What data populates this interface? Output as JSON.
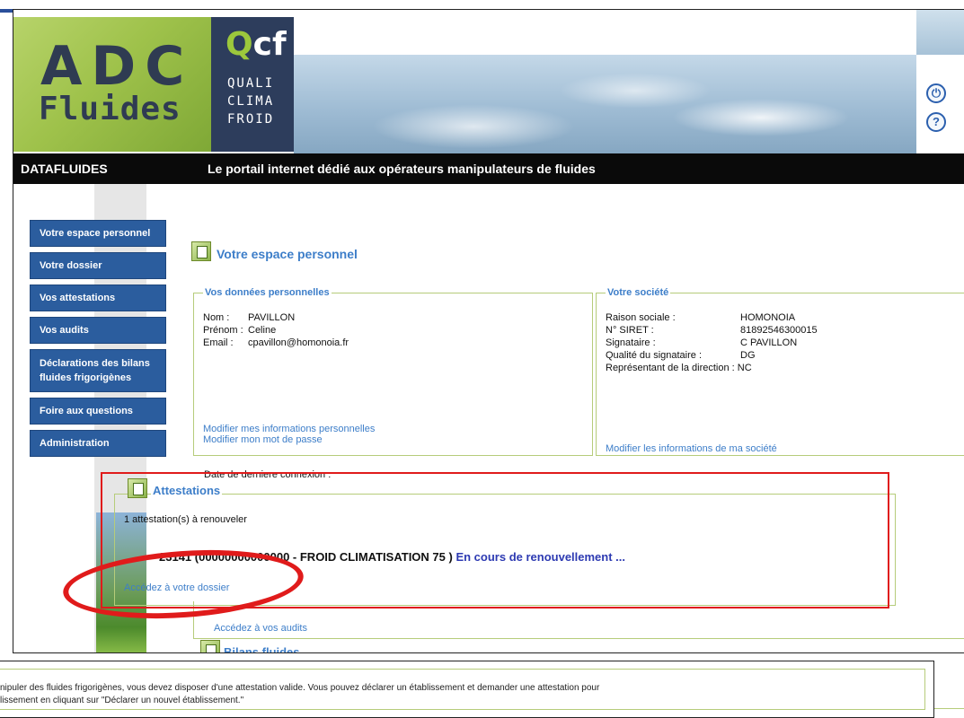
{
  "header": {
    "logo_adc": "ADC",
    "logo_fluides": "Fluides",
    "logo_qcf_mark": "Q",
    "logo_qcf_mark_rest": "cf",
    "logo_qcf_lines": [
      "QUALI",
      "CLIMA",
      "FROID"
    ],
    "power_glyph": "⏻",
    "help_glyph": "?"
  },
  "band": {
    "brand": "DATAFLUIDES",
    "tagline": "Le portail internet dédié aux opérateurs manipulateurs de fluides"
  },
  "nav": {
    "items": [
      {
        "label": "Votre espace personnel"
      },
      {
        "label": "Votre dossier"
      },
      {
        "label": "Vos attestations"
      },
      {
        "label": "Vos audits"
      },
      {
        "label": "Déclarations des bilans fluides frigorigènes"
      },
      {
        "label": "Foire aux questions"
      },
      {
        "label": "Administration"
      }
    ]
  },
  "page": {
    "title": "Votre espace personnel"
  },
  "personal": {
    "legend": "Vos données personnelles",
    "rows": [
      {
        "key": "Nom :",
        "value": "PAVILLON"
      },
      {
        "key": "Prénom :",
        "value": "Celine"
      },
      {
        "key": "Email :",
        "value": "cpavillon@homonoia.fr"
      }
    ],
    "link_edit_info": "Modifier mes informations personnelles",
    "link_edit_password": "Modifier mon mot de passe"
  },
  "company": {
    "legend": "Votre société",
    "rows": [
      {
        "key": "Raison sociale :",
        "value": "HOMONOIA"
      },
      {
        "key": "N° SIRET :",
        "value": "81892546300015"
      },
      {
        "key": "Signataire :",
        "value": "C PAVILLON"
      },
      {
        "key": "Qualité du signataire :",
        "value": "DG"
      },
      {
        "key": "Représentant de la direction :",
        "value": "NC"
      }
    ],
    "link_edit": "Modifier les informations de ma société"
  },
  "last_connection": "Date de derniere connexion :",
  "attestations": {
    "title": "Attestations",
    "count": "1 attestation(s) à renouveler",
    "item": "23141 (00000000000000 - FROID CLIMATISATION 75 )",
    "status": "En cours de renouvellement ...",
    "link_dossier": "Accédez à votre dossier"
  },
  "audits": {
    "link": "Accédez à vos audits"
  },
  "bilans": {
    "title": "Bilans fluides"
  },
  "bottom": {
    "line1": "nipuler des fluides frigorigènes, vous devez disposer d'une attestation valide. Vous pouvez déclarer un établissement et demander une attestation pour",
    "line2": "lissement en cliquant sur \"Déclarer un nouvel établissement.\""
  },
  "colors": {
    "nav_blue": "#2b5d9e",
    "link_blue": "#3d7ec9",
    "highlight_red": "#e01b1b",
    "box_border_green": "#b6cc7a"
  }
}
